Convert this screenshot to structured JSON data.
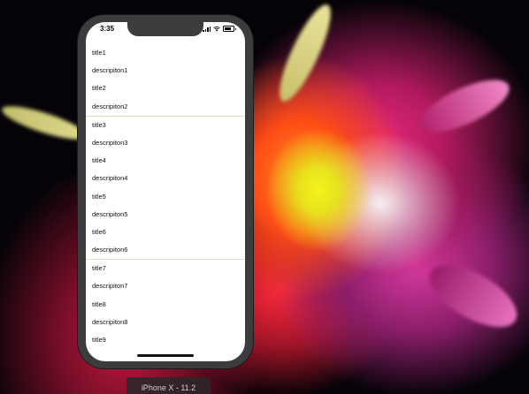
{
  "status_bar": {
    "time": "3:35"
  },
  "table": {
    "sections": [
      {
        "rows": [
          "title1",
          "descripiton1",
          "title2",
          "descripiton2"
        ]
      },
      {
        "rows": [
          "title3",
          "descripiton3",
          "title4",
          "descripiton4",
          "title5",
          "descripiton5",
          "title6",
          "descripiton6"
        ]
      },
      {
        "rows": [
          "title7",
          "descripiton7",
          "title8",
          "descripiton8",
          "title9"
        ]
      }
    ]
  },
  "simulator": {
    "device_label": "iPhone X - 11.2"
  },
  "icons": {
    "signal": "signal-icon",
    "wifi": "wifi-icon",
    "battery": "battery-icon"
  }
}
